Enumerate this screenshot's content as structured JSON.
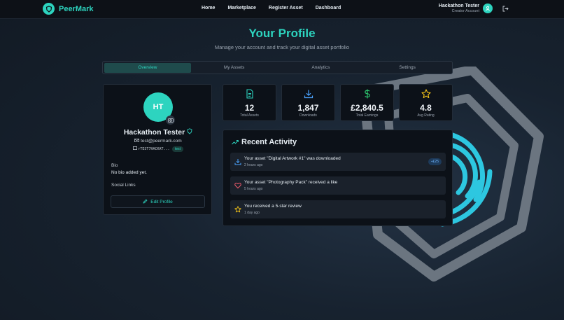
{
  "brand": {
    "name": "PeerMark",
    "logo_icon": "shield-icon"
  },
  "nav": {
    "links": [
      "Home",
      "Marketplace",
      "Register Asset",
      "Dashboard"
    ]
  },
  "user": {
    "name": "Hackathon Tester",
    "role": "Creator Account",
    "avatar_icon": "user-icon",
    "logout_icon": "logout-icon"
  },
  "header": {
    "title": "Your Profile",
    "subtitle": "Manage your account and track your digital asset portfolio"
  },
  "tabs": [
    {
      "label": "Overview",
      "active": true
    },
    {
      "label": "My Assets",
      "active": false
    },
    {
      "label": "Analytics",
      "active": false
    },
    {
      "label": "Settings",
      "active": false
    }
  ],
  "profile": {
    "initials": "HT",
    "name": "Hackathon Tester",
    "email": "test@peermark.com",
    "wallet": "rTEST7HACKAT...",
    "wallet_tag": "test",
    "bio_label": "Bio",
    "bio_text": "No bio added yet.",
    "social_label": "Social Links",
    "edit_button": "Edit Profile"
  },
  "stats": [
    {
      "value": "12",
      "label": "Total Assets",
      "icon": "file-icon"
    },
    {
      "value": "1,847",
      "label": "Downloads",
      "icon": "download-icon"
    },
    {
      "value": "£2,840.5",
      "label": "Total Earnings",
      "icon": "dollar-icon"
    },
    {
      "value": "4.8",
      "label": "Avg Rating",
      "icon": "star-icon"
    }
  ],
  "activity": {
    "title": "Recent Activity",
    "items": [
      {
        "text": "Your asset \"Digital Artwork #1\" was downloaded",
        "time": "2 hours ago",
        "badge": "+£25",
        "icon": "download-icon"
      },
      {
        "text": "Your asset \"Photography Pack\" received a like",
        "time": "5 hours ago",
        "badge": "",
        "icon": "heart-icon"
      },
      {
        "text": "You received a 5-star review",
        "time": "1 day ago",
        "badge": "",
        "icon": "star-icon"
      }
    ]
  },
  "colors": {
    "accent": "#2dd4bf",
    "background": "#17222f",
    "card": "#0c1118"
  }
}
